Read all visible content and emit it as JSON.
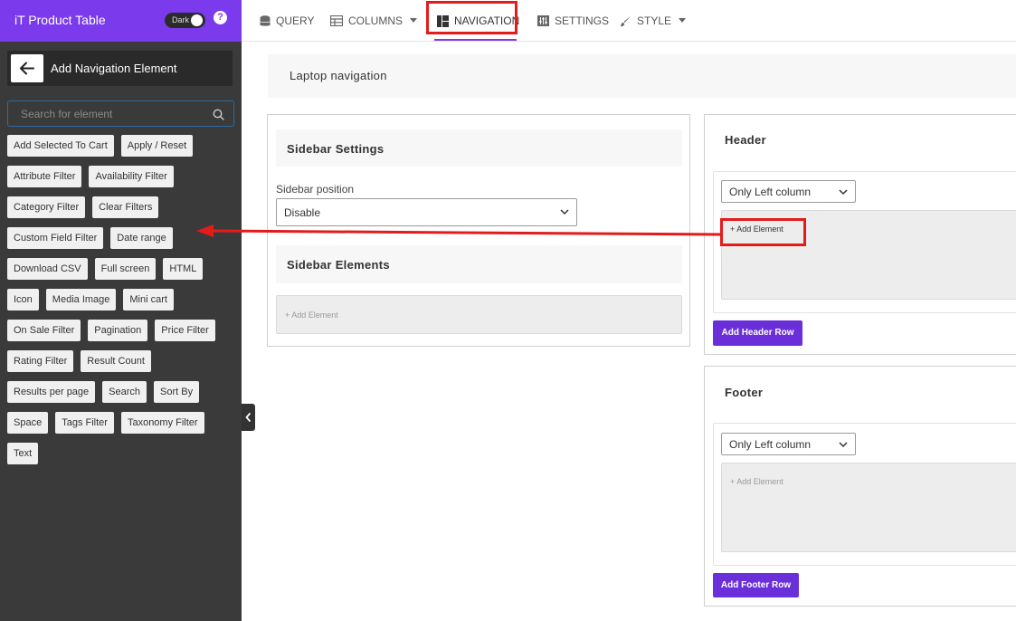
{
  "sidebar": {
    "title": "iT Product Table",
    "dark_label": "Dark",
    "help": "?",
    "panel_title": "Add Navigation Element",
    "search_placeholder": "Search for element",
    "elements": [
      [
        "Add Selected To Cart",
        "Apply / Reset"
      ],
      [
        "Attribute Filter",
        "Availability Filter"
      ],
      [
        "Category Filter",
        "Clear Filters"
      ],
      [
        "Custom Field Filter",
        "Date range"
      ],
      [
        "Download CSV",
        "Full screen",
        "HTML"
      ],
      [
        "Icon",
        "Media Image",
        "Mini cart"
      ],
      [
        "On Sale Filter",
        "Pagination",
        "Price Filter"
      ],
      [
        "Rating Filter",
        "Result Count"
      ],
      [
        "Results per page",
        "Search",
        "Sort By"
      ],
      [
        "Space",
        "Tags Filter",
        "Taxonomy Filter"
      ],
      [
        "Text"
      ]
    ]
  },
  "tabs": [
    {
      "label": "QUERY",
      "icon": "database-icon"
    },
    {
      "label": "COLUMNS",
      "icon": "table-icon"
    },
    {
      "label": "NAVIGATION",
      "icon": "layout-icon"
    },
    {
      "label": "SETTINGS",
      "icon": "sliders-icon"
    },
    {
      "label": "STYLE",
      "icon": "brush-icon"
    }
  ],
  "active_tab": "NAVIGATION",
  "main": {
    "laptop_title": "Laptop navigation",
    "sidebar_settings_title": "Sidebar Settings",
    "sidebar_position_label": "Sidebar position",
    "sidebar_position_value": "Disable",
    "sidebar_elements_title": "Sidebar Elements",
    "sidebar_add_element": "+ Add Element",
    "header_title": "Header",
    "header_column_value": "Only Left column",
    "header_add_element": "+ Add Element",
    "add_header_row": "Add Header Row",
    "footer_title": "Footer",
    "footer_column_value": "Only Left column",
    "footer_add_element": "+ Add Element",
    "add_footer_row": "Add Footer Row"
  },
  "colors": {
    "accent": "#7c3aed",
    "button": "#6b2fd9",
    "annotation": "#e31b1b",
    "sidebar_bg": "#3a3a3a"
  }
}
